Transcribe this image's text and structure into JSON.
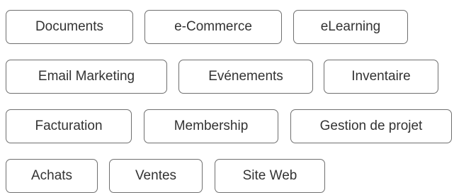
{
  "tags": {
    "documents": "Documents",
    "ecommerce": "e-Commerce",
    "elearning": "eLearning",
    "email_marketing": "Email Marketing",
    "evenements": "Evénements",
    "inventaire": "Inventaire",
    "facturation": "Facturation",
    "membership": "Membership",
    "gestion_de_projet": "Gestion de projet",
    "achats": "Achats",
    "ventes": "Ventes",
    "site_web": "Site Web"
  },
  "colors": {
    "border": "#6f6f6f",
    "text": "#333333",
    "background": "#ffffff"
  }
}
